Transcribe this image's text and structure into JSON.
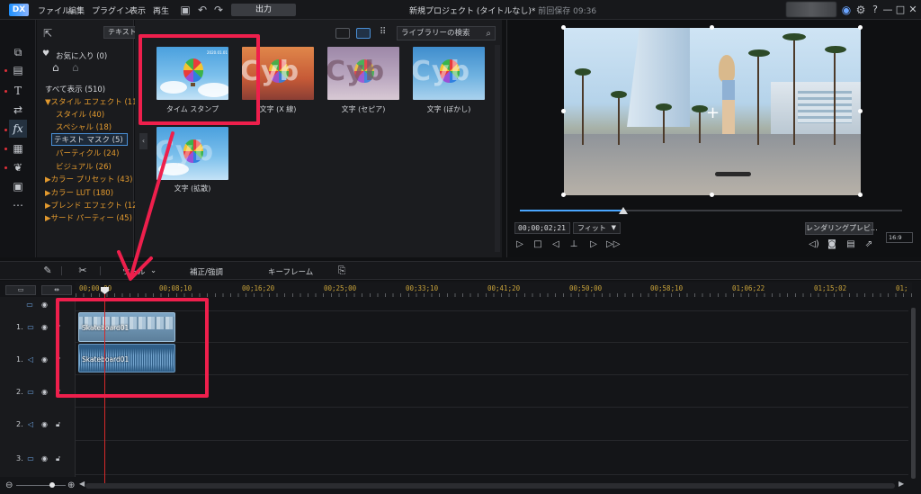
{
  "app": {
    "logo_text": "DX",
    "menu": [
      "ファイル",
      "編集",
      "プラグイン",
      "表示",
      "再生"
    ],
    "output_label": "出力",
    "project_title": "新規プロジェクト (タイトルなし)*",
    "saved_text": "前回保存 09:36",
    "window_controls": [
      "?",
      "—",
      "□",
      "✕"
    ]
  },
  "library": {
    "dropdown_label": "テキスト マス",
    "favorites_label": "お気に入り (0)",
    "tree": [
      {
        "label": "すべて表示 (510)",
        "style": "white"
      },
      {
        "label": "▼スタイル エフェクト (113)",
        "style": "orange"
      },
      {
        "label": "スタイル (40)",
        "style": "orange"
      },
      {
        "label": "スペシャル (18)",
        "style": "orange"
      },
      {
        "label": "テキスト マスク (5)",
        "style": "selected"
      },
      {
        "label": "パーティクル (24)",
        "style": "orange"
      },
      {
        "label": "ビジュアル (26)",
        "style": "orange"
      },
      {
        "label": "▶カラー プリセット (43)",
        "style": "orange"
      },
      {
        "label": "▶カラー LUT (180)",
        "style": "orange"
      },
      {
        "label": "▶ブレンド エフェクト (129)",
        "style": "orange"
      },
      {
        "label": "▶サード パーティー (45)",
        "style": "orange"
      }
    ],
    "search_placeholder": "ライブラリーの検索",
    "items": [
      {
        "label": "タイム スタンプ",
        "overlay": ""
      },
      {
        "label": "文字 (X 線)",
        "overlay": "Cyb"
      },
      {
        "label": "文字 (セピア)",
        "overlay": "Cyb"
      },
      {
        "label": "文字 (ぼかし)",
        "overlay": "Cyb"
      },
      {
        "label": "文字 (拡散)",
        "overlay": "Cyb"
      }
    ]
  },
  "preview": {
    "timecode": "00;00;02;21",
    "fit_label": "フィット",
    "render_label": "レンダリングプレビ...",
    "ratio_label": "16:9",
    "seek_progress": 0.27
  },
  "timeline_toolbar": {
    "tools_label": "ツール",
    "fix_label": "補正/強調",
    "keyframe_label": "キーフレーム"
  },
  "timeline": {
    "ruler": [
      "00;00;00",
      "00;08;10",
      "00;16;20",
      "00;25;00",
      "00;33;10",
      "00;41;20",
      "00;50;00",
      "00;58;10",
      "01;06;22",
      "01;15;02",
      "01;"
    ],
    "tracks": [
      "1.",
      "1.",
      "2.",
      "2.",
      "3."
    ],
    "video_clip_name": "Skateboard01",
    "audio_clip_name": "Skateboard01"
  },
  "annotation": {
    "color": "#ee1f4c"
  }
}
